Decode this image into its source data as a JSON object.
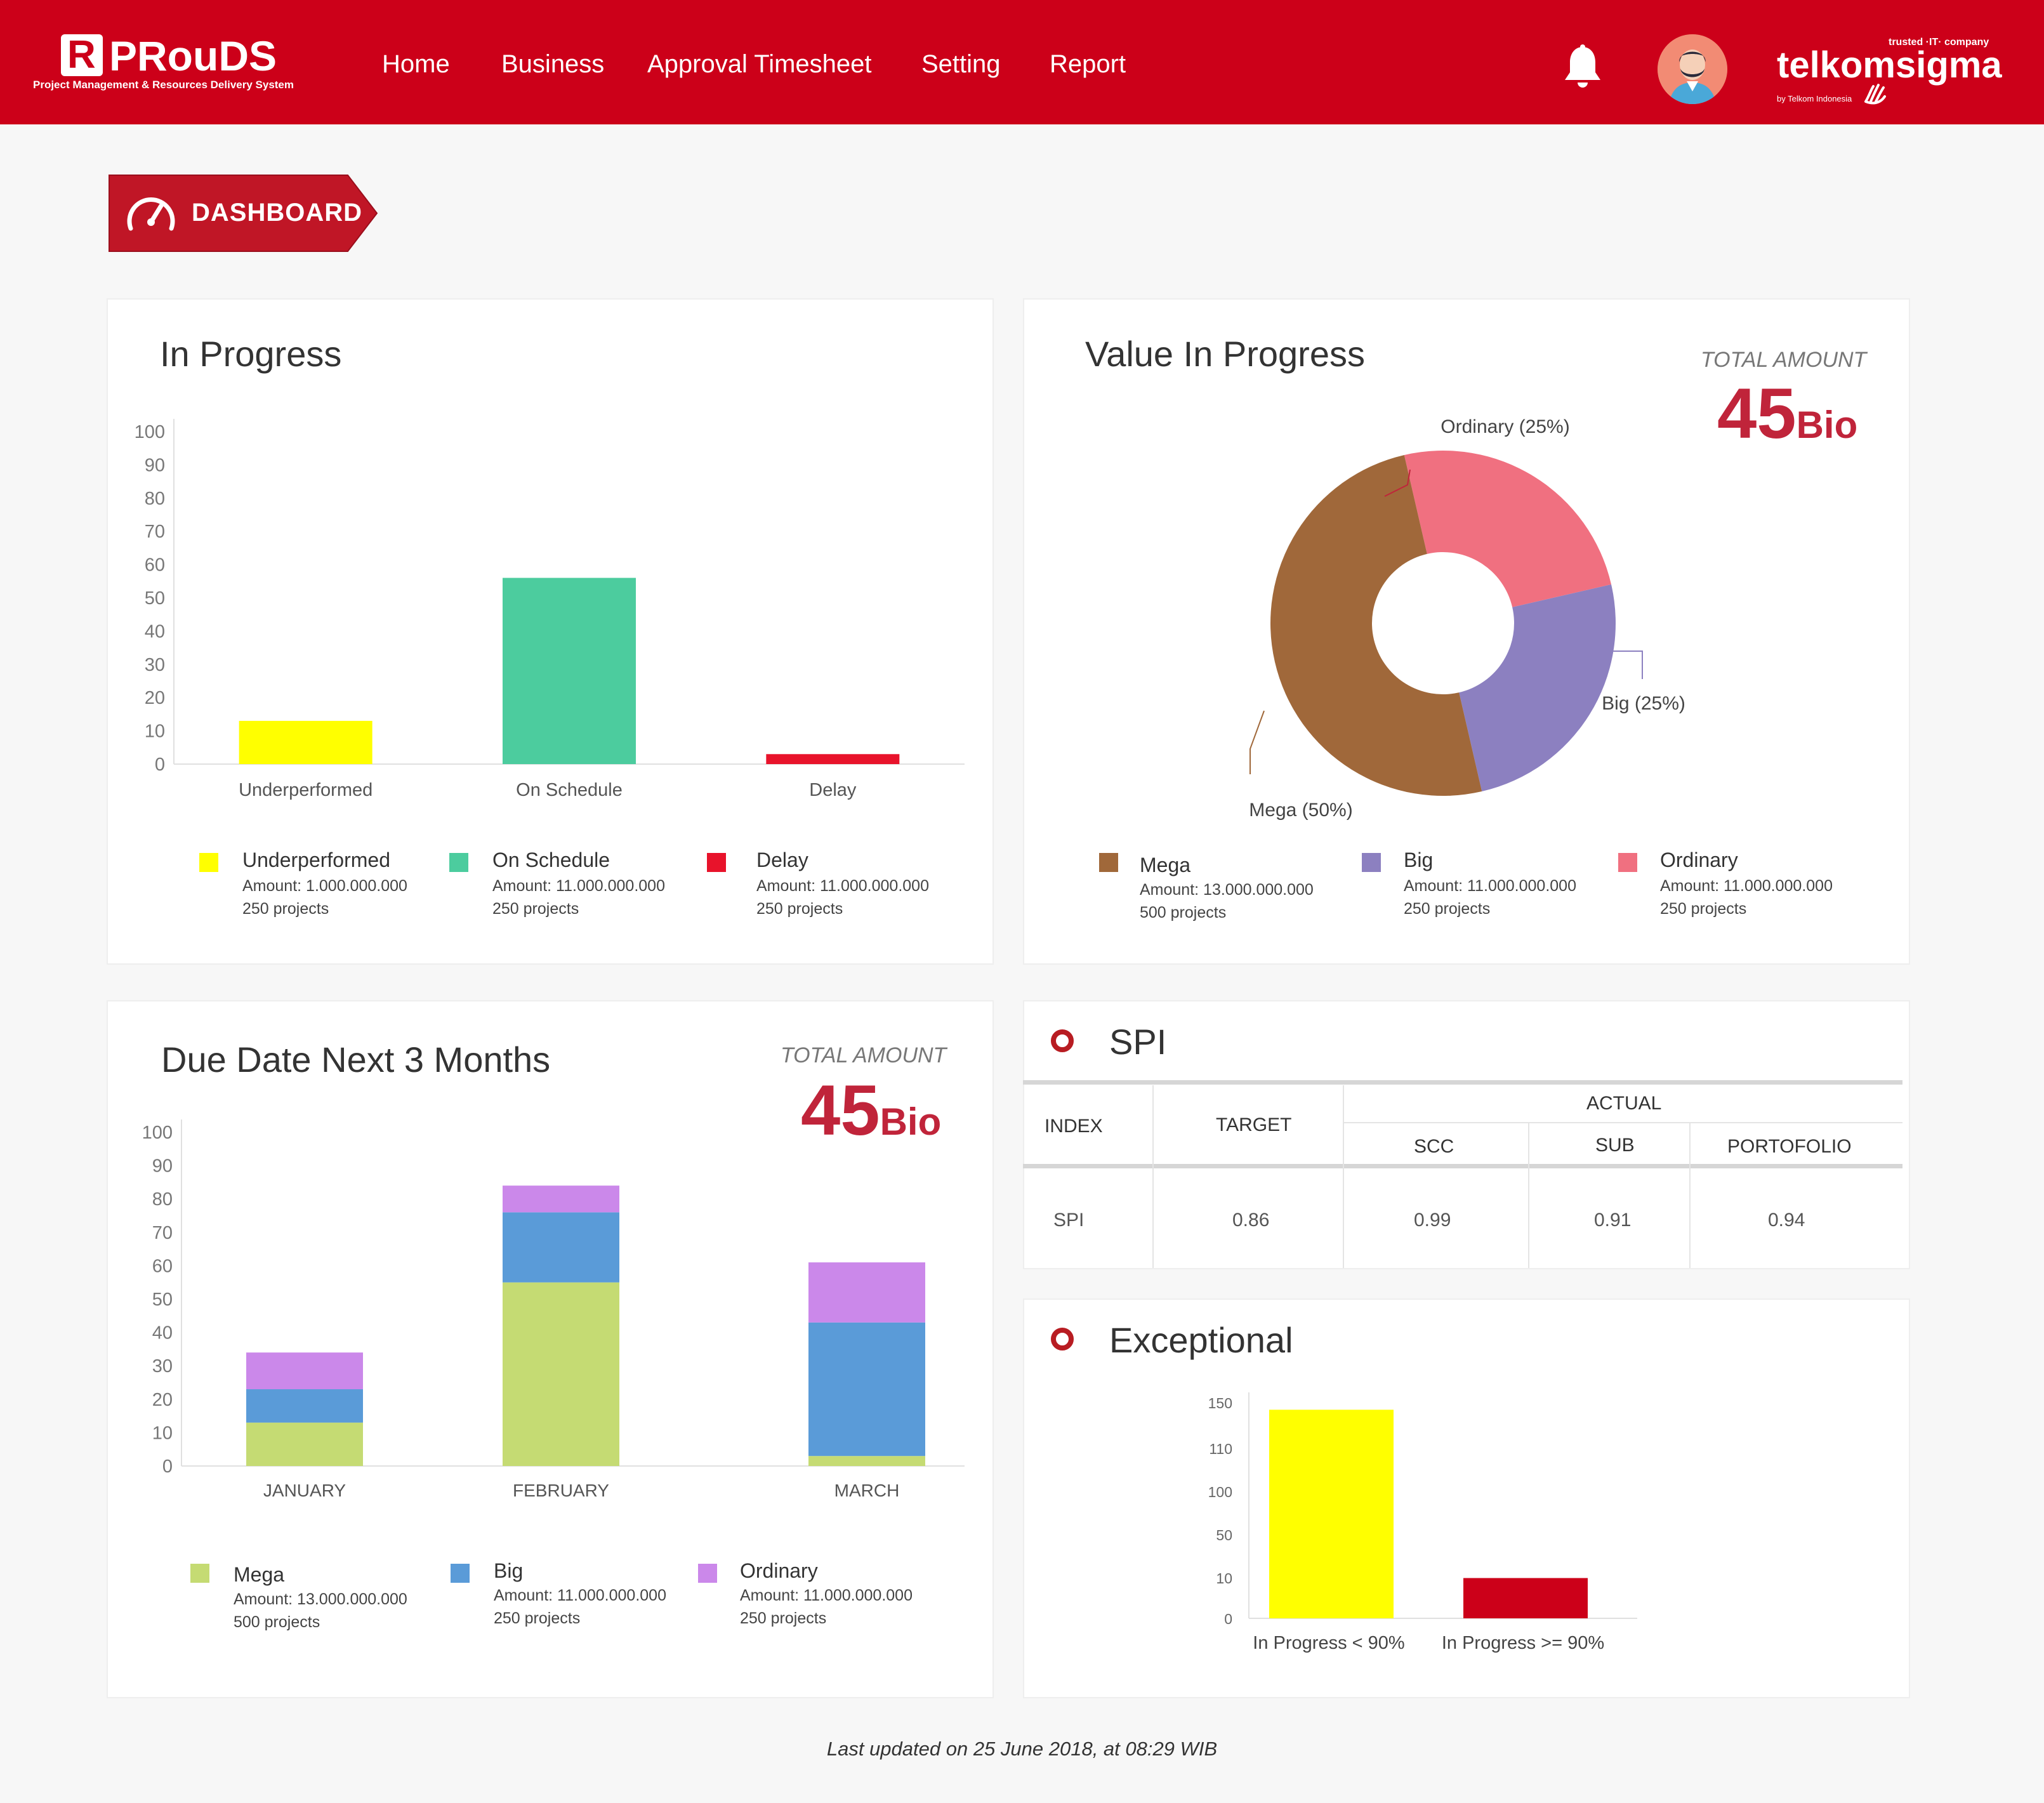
{
  "header": {
    "logo_letter": "R",
    "app_name": "PRouDS",
    "app_subtitle": "Project Management & Resources Delivery System",
    "nav": [
      {
        "label": "Home"
      },
      {
        "label": "Business"
      },
      {
        "label": "Approval Timesheet"
      },
      {
        "label": "Setting"
      },
      {
        "label": "Report"
      }
    ],
    "brand_tagline": "trusted ·IT· company",
    "brand_name": "telkomsigma",
    "brand_by": "by Telkom Indonesia",
    "icons": {
      "notification": "bell-icon",
      "user": "avatar",
      "dashboard": "speedometer-icon"
    },
    "colors": {
      "primary": "#cc0019",
      "accent": "#c0243a"
    }
  },
  "page": {
    "section_title": "DASHBOARD",
    "footer": "Last updated on 25 June 2018, at 08:29 WIB"
  },
  "in_progress": {
    "title": "In Progress",
    "chart_data": {
      "type": "bar",
      "categories": [
        "Underperformed",
        "On Schedule",
        "Delay"
      ],
      "values": [
        13,
        56,
        3
      ],
      "colors": [
        "#ffff00",
        "#4ccc9e",
        "#e8132b"
      ],
      "ylim": [
        0,
        100
      ],
      "yticks": [
        "100",
        "90",
        "80",
        "70",
        "60",
        "50",
        "40",
        "30",
        "20",
        "10",
        "0"
      ]
    },
    "legend": [
      {
        "name": "Underperformed",
        "amount": "Amount: 1.000.000.000",
        "projects": "250 projects",
        "color": "#ffff00"
      },
      {
        "name": "On Schedule",
        "amount": "Amount: 11.000.000.000",
        "projects": "250 projects",
        "color": "#4ccc9e"
      },
      {
        "name": "Delay",
        "amount": "Amount: 11.000.000.000",
        "projects": "250 projects",
        "color": "#e8132b"
      }
    ]
  },
  "value_in_progress": {
    "title": "Value In Progress",
    "total_label": "TOTAL AMOUNT",
    "total_value": "45",
    "total_unit": "Bio",
    "chart_data": {
      "type": "pie",
      "donut": true,
      "slices": [
        {
          "name": "Mega",
          "label": "Mega (50%)",
          "value": 50,
          "color": "#a0683a"
        },
        {
          "name": "Big",
          "label": "Big (25%)",
          "value": 25,
          "color": "#8c80c0"
        },
        {
          "name": "Ordinary",
          "label": "Ordinary (25%)",
          "value": 25,
          "color": "#f07080"
        }
      ]
    },
    "legend": [
      {
        "name": "Mega",
        "amount": "Amount: 13.000.000.000",
        "projects": "500 projects",
        "color": "#a0683a"
      },
      {
        "name": "Big",
        "amount": "Amount: 11.000.000.000",
        "projects": "250 projects",
        "color": "#8c80c0"
      },
      {
        "name": "Ordinary",
        "amount": "Amount: 11.000.000.000",
        "projects": "250 projects",
        "color": "#f07080"
      }
    ]
  },
  "due_date": {
    "title": "Due Date Next 3 Months",
    "total_label": "TOTAL AMOUNT",
    "total_value": "45",
    "total_unit": "Bio",
    "chart_data": {
      "type": "bar",
      "stacked": true,
      "categories": [
        "JANUARY",
        "FEBRUARY",
        "MARCH"
      ],
      "series": [
        {
          "name": "Mega",
          "values": [
            13,
            55,
            3
          ],
          "color": "#c5db73"
        },
        {
          "name": "Big",
          "values": [
            10,
            21,
            40
          ],
          "color": "#5a9bd8"
        },
        {
          "name": "Ordinary",
          "values": [
            11,
            8,
            18
          ],
          "color": "#cb88ea"
        }
      ],
      "ylim": [
        0,
        100
      ],
      "yticks": [
        "100",
        "90",
        "80",
        "70",
        "60",
        "50",
        "40",
        "30",
        "20",
        "10",
        "0"
      ]
    },
    "legend": [
      {
        "name": "Mega",
        "amount": "Amount: 13.000.000.000",
        "projects": "500 projects",
        "color": "#c5db73"
      },
      {
        "name": "Big",
        "amount": "Amount: 11.000.000.000",
        "projects": "250 projects",
        "color": "#5a9bd8"
      },
      {
        "name": "Ordinary",
        "amount": "Amount: 11.000.000.000",
        "projects": "250 projects",
        "color": "#cb88ea"
      }
    ]
  },
  "spi": {
    "title": "SPI",
    "headers": {
      "index": "INDEX",
      "target": "TARGET",
      "actual": "ACTUAL",
      "scc": "SCC",
      "sub": "SUB",
      "portofolio": "PORTOFOLIO"
    },
    "row": {
      "index": "SPI",
      "target": "0.86",
      "scc": "0.99",
      "sub": "0.91",
      "portofolio": "0.94"
    }
  },
  "exceptional": {
    "title": "Exceptional",
    "chart_data": {
      "type": "bar",
      "categories": [
        "In Progress < 90%",
        "In Progress >= 90%"
      ],
      "values": [
        145,
        28
      ],
      "colors": [
        "#ffff00",
        "#cc0019"
      ],
      "yticks": [
        "150",
        "110",
        "100",
        "50",
        "10",
        "0"
      ]
    }
  }
}
